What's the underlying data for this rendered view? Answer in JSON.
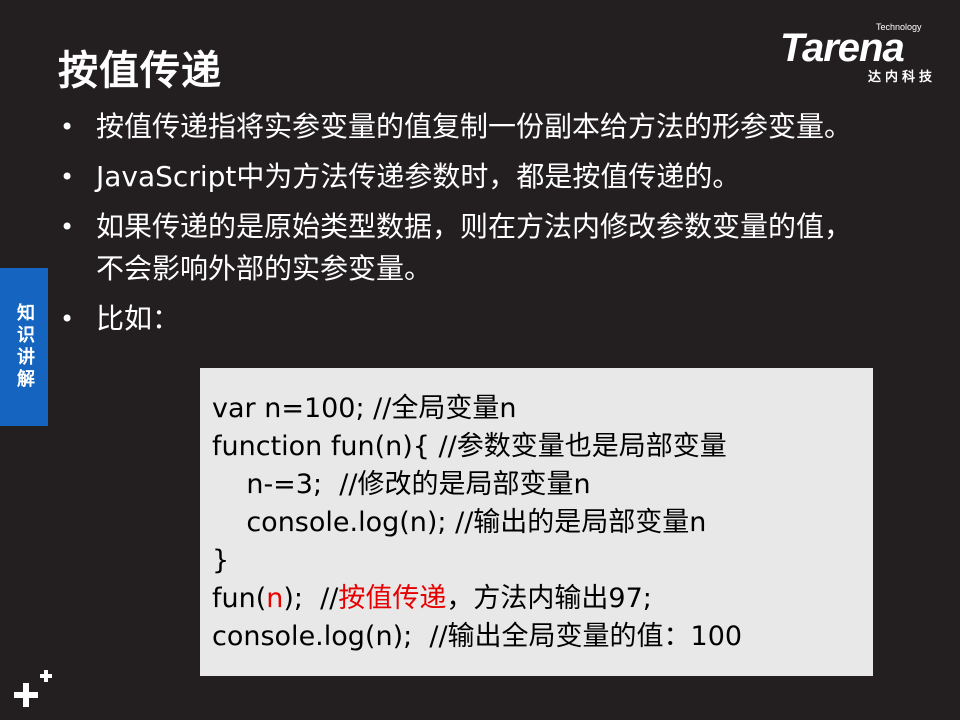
{
  "title": "按值传递",
  "logo": {
    "word": "Tarena",
    "tech": "Technology",
    "cn": "达内科技"
  },
  "side_tab": "知识讲解",
  "bullets": [
    "按值传递指将实参变量的值复制一份副本给方法的形参变量。",
    "JavaScript中为方法传递参数时，都是按值传递的。",
    "如果传递的是原始类型数据，则在方法内修改参数变量的值，不会影响外部的实参变量。",
    "比如："
  ],
  "code": {
    "line1": "var n=100; //全局变量n",
    "line2": "function fun(n){ //参数变量也是局部变量",
    "line3": "    n-=3;  //修改的是局部变量n",
    "line4": "    console.log(n); //输出的是局部变量n",
    "line5": "}",
    "line6_a": "fun(",
    "line6_b": "n",
    "line6_c": ");  //",
    "line6_d": "按值传递",
    "line6_e": "，方法内输出97;",
    "line7": "console.log(n);  //输出全局变量的值：100"
  },
  "colors": {
    "background": "#231f20",
    "side_tab": "#1565c0",
    "code_bg": "#e8e8e8",
    "highlight": "#e60000"
  },
  "icons": {
    "corner": "plus-icon"
  }
}
